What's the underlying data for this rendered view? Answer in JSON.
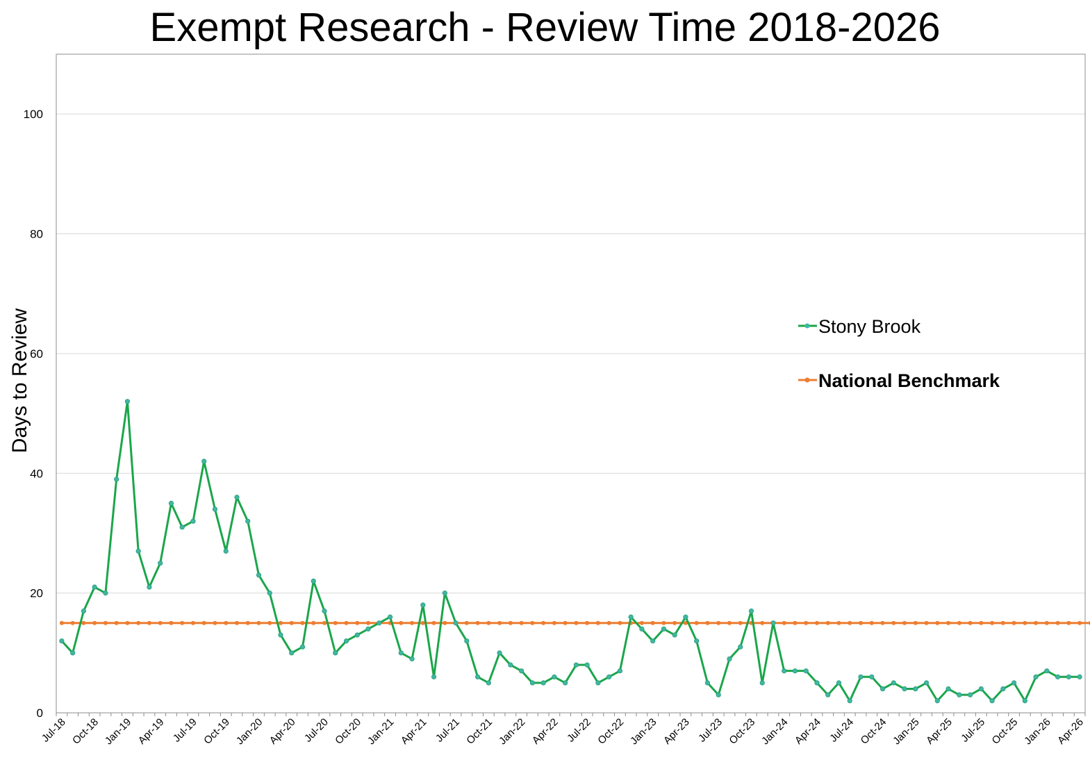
{
  "chart_data": {
    "type": "line",
    "title": "Exempt Research - Review Time 2018-2026",
    "ylabel": "Days to Review",
    "xlabel": "",
    "ylim": [
      0,
      110
    ],
    "yticks": [
      0,
      20,
      40,
      60,
      80,
      100
    ],
    "grid": true,
    "legend_position": "right",
    "x_tick_labels": [
      "Jul-18",
      "Oct-18",
      "Jan-19",
      "Apr-19",
      "Jul-19",
      "Oct-19",
      "Jan-20",
      "Apr-20",
      "Jul-20",
      "Oct-20",
      "Jan-21",
      "Apr-21",
      "Jul-21",
      "Oct-21",
      "Jan-22",
      "Apr-22",
      "Jul-22",
      "Oct-22",
      "Jan-23",
      "Apr-23",
      "Jul-23",
      "Oct-23",
      "Jan-24",
      "Apr-24",
      "Jul-24",
      "Oct-24",
      "Jan-25",
      "Apr-25",
      "Jul-25",
      "Oct-25",
      "Jan-26",
      "Apr-26"
    ],
    "series": [
      {
        "name": "Stony Brook",
        "color": "#1aa64a",
        "marker_color": "#3fb8a0",
        "values": [
          12,
          10,
          17,
          21,
          20,
          39,
          52,
          27,
          21,
          25,
          35,
          31,
          32,
          42,
          34,
          27,
          36,
          32,
          23,
          20,
          13,
          10,
          11,
          22,
          17,
          10,
          12,
          13,
          14,
          15,
          16,
          10,
          9,
          18,
          6,
          20,
          15,
          12,
          6,
          5,
          10,
          8,
          7,
          5,
          5,
          6,
          5,
          8,
          8,
          5,
          6,
          7,
          16,
          14,
          12,
          14,
          13,
          16,
          12,
          5,
          3,
          9,
          11,
          17,
          5,
          15,
          7,
          7,
          7,
          5,
          3,
          5,
          2,
          6,
          6,
          4,
          5,
          4,
          4,
          5,
          2,
          4,
          3,
          3,
          4,
          2,
          4,
          5,
          2,
          6,
          7,
          6,
          6,
          6
        ]
      },
      {
        "name": "National Benchmark",
        "color": "#ed7d31",
        "marker_color": "#ed7d31",
        "constant": 15,
        "count": 96
      }
    ]
  }
}
